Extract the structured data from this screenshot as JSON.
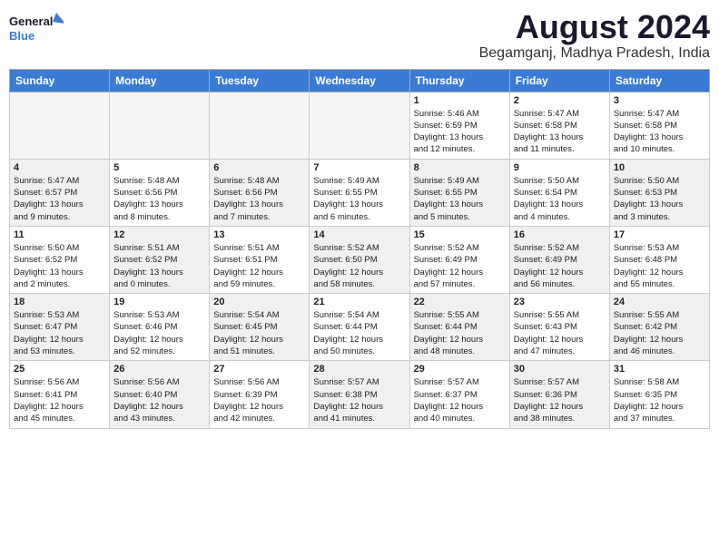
{
  "header": {
    "logo_text_general": "General",
    "logo_text_blue": "Blue",
    "month_title": "August 2024",
    "location": "Begamganj, Madhya Pradesh, India"
  },
  "days_of_week": [
    "Sunday",
    "Monday",
    "Tuesday",
    "Wednesday",
    "Thursday",
    "Friday",
    "Saturday"
  ],
  "weeks": [
    [
      {
        "day": "",
        "info": "",
        "empty": true
      },
      {
        "day": "",
        "info": "",
        "empty": true
      },
      {
        "day": "",
        "info": "",
        "empty": true
      },
      {
        "day": "",
        "info": "",
        "empty": true
      },
      {
        "day": "1",
        "info": "Sunrise: 5:46 AM\nSunset: 6:59 PM\nDaylight: 13 hours\nand 12 minutes."
      },
      {
        "day": "2",
        "info": "Sunrise: 5:47 AM\nSunset: 6:58 PM\nDaylight: 13 hours\nand 11 minutes."
      },
      {
        "day": "3",
        "info": "Sunrise: 5:47 AM\nSunset: 6:58 PM\nDaylight: 13 hours\nand 10 minutes."
      }
    ],
    [
      {
        "day": "4",
        "info": "Sunrise: 5:47 AM\nSunset: 6:57 PM\nDaylight: 13 hours\nand 9 minutes.",
        "shaded": true
      },
      {
        "day": "5",
        "info": "Sunrise: 5:48 AM\nSunset: 6:56 PM\nDaylight: 13 hours\nand 8 minutes."
      },
      {
        "day": "6",
        "info": "Sunrise: 5:48 AM\nSunset: 6:56 PM\nDaylight: 13 hours\nand 7 minutes.",
        "shaded": true
      },
      {
        "day": "7",
        "info": "Sunrise: 5:49 AM\nSunset: 6:55 PM\nDaylight: 13 hours\nand 6 minutes."
      },
      {
        "day": "8",
        "info": "Sunrise: 5:49 AM\nSunset: 6:55 PM\nDaylight: 13 hours\nand 5 minutes.",
        "shaded": true
      },
      {
        "day": "9",
        "info": "Sunrise: 5:50 AM\nSunset: 6:54 PM\nDaylight: 13 hours\nand 4 minutes."
      },
      {
        "day": "10",
        "info": "Sunrise: 5:50 AM\nSunset: 6:53 PM\nDaylight: 13 hours\nand 3 minutes.",
        "shaded": true
      }
    ],
    [
      {
        "day": "11",
        "info": "Sunrise: 5:50 AM\nSunset: 6:52 PM\nDaylight: 13 hours\nand 2 minutes."
      },
      {
        "day": "12",
        "info": "Sunrise: 5:51 AM\nSunset: 6:52 PM\nDaylight: 13 hours\nand 0 minutes.",
        "shaded": true
      },
      {
        "day": "13",
        "info": "Sunrise: 5:51 AM\nSunset: 6:51 PM\nDaylight: 12 hours\nand 59 minutes."
      },
      {
        "day": "14",
        "info": "Sunrise: 5:52 AM\nSunset: 6:50 PM\nDaylight: 12 hours\nand 58 minutes.",
        "shaded": true
      },
      {
        "day": "15",
        "info": "Sunrise: 5:52 AM\nSunset: 6:49 PM\nDaylight: 12 hours\nand 57 minutes."
      },
      {
        "day": "16",
        "info": "Sunrise: 5:52 AM\nSunset: 6:49 PM\nDaylight: 12 hours\nand 56 minutes.",
        "shaded": true
      },
      {
        "day": "17",
        "info": "Sunrise: 5:53 AM\nSunset: 6:48 PM\nDaylight: 12 hours\nand 55 minutes."
      }
    ],
    [
      {
        "day": "18",
        "info": "Sunrise: 5:53 AM\nSunset: 6:47 PM\nDaylight: 12 hours\nand 53 minutes.",
        "shaded": true
      },
      {
        "day": "19",
        "info": "Sunrise: 5:53 AM\nSunset: 6:46 PM\nDaylight: 12 hours\nand 52 minutes."
      },
      {
        "day": "20",
        "info": "Sunrise: 5:54 AM\nSunset: 6:45 PM\nDaylight: 12 hours\nand 51 minutes.",
        "shaded": true
      },
      {
        "day": "21",
        "info": "Sunrise: 5:54 AM\nSunset: 6:44 PM\nDaylight: 12 hours\nand 50 minutes."
      },
      {
        "day": "22",
        "info": "Sunrise: 5:55 AM\nSunset: 6:44 PM\nDaylight: 12 hours\nand 48 minutes.",
        "shaded": true
      },
      {
        "day": "23",
        "info": "Sunrise: 5:55 AM\nSunset: 6:43 PM\nDaylight: 12 hours\nand 47 minutes."
      },
      {
        "day": "24",
        "info": "Sunrise: 5:55 AM\nSunset: 6:42 PM\nDaylight: 12 hours\nand 46 minutes.",
        "shaded": true
      }
    ],
    [
      {
        "day": "25",
        "info": "Sunrise: 5:56 AM\nSunset: 6:41 PM\nDaylight: 12 hours\nand 45 minutes."
      },
      {
        "day": "26",
        "info": "Sunrise: 5:56 AM\nSunset: 6:40 PM\nDaylight: 12 hours\nand 43 minutes.",
        "shaded": true
      },
      {
        "day": "27",
        "info": "Sunrise: 5:56 AM\nSunset: 6:39 PM\nDaylight: 12 hours\nand 42 minutes."
      },
      {
        "day": "28",
        "info": "Sunrise: 5:57 AM\nSunset: 6:38 PM\nDaylight: 12 hours\nand 41 minutes.",
        "shaded": true
      },
      {
        "day": "29",
        "info": "Sunrise: 5:57 AM\nSunset: 6:37 PM\nDaylight: 12 hours\nand 40 minutes."
      },
      {
        "day": "30",
        "info": "Sunrise: 5:57 AM\nSunset: 6:36 PM\nDaylight: 12 hours\nand 38 minutes.",
        "shaded": true
      },
      {
        "day": "31",
        "info": "Sunrise: 5:58 AM\nSunset: 6:35 PM\nDaylight: 12 hours\nand 37 minutes."
      }
    ]
  ]
}
